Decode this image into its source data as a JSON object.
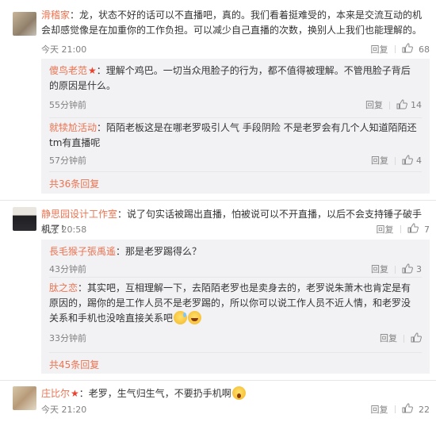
{
  "labels": {
    "reply": "回复"
  },
  "comments": [
    {
      "user": "滑稽家",
      "text": "：龙，状态不好的话可以不直播吧，真的。我们看着挺难受的，本来是交流互动的机会却感觉像是在加重你的工作负担。可以减少自己直播的次数，换别人上我们也能理解的。",
      "time": "今天 21:00",
      "likes": "68",
      "replies": [
        {
          "user": "傻鸟老范",
          "badge": "★",
          "text": "：理解个鸡巴。一切当众甩脸子的行为，都不值得被理解。不管甩脸子背后的原因是什么。",
          "time": "55分钟前",
          "likes": "14"
        },
        {
          "user": "就犊尬活动",
          "badge": "",
          "text": "：陌陌老板这是在哪老罗吸引人气 手段阴险 不是老罗会有几个人知道陌陌还tm有直播呢",
          "time": "57分钟前",
          "likes": "4"
        }
      ],
      "more": "共36条回复"
    },
    {
      "user": "静思园设计工作室",
      "text": "：说了句实话被踢出直播，怕被说可以不开直播，以后不会支持锤子破手机了！",
      "time": "今天 20:58",
      "likes": "7",
      "replies": [
        {
          "user": "長毛猴子張禹遙",
          "badge": "",
          "text": "：那是老罗踢得么？",
          "time": "43分钟前",
          "likes": "3"
        },
        {
          "user": "肽之恋",
          "badge": "",
          "text": "：其实吧，互相理解一下，去陌陌老罗也是卖身去的，老罗说朱萧木也肯定是有原因的，踢你的是工作人员不是老罗踢的，所以你可以说工作人员不近人情，和老罗没关系和手机也没啥直接关系吧",
          "time": "33分钟前",
          "likes": ""
        }
      ],
      "more": "共45条回复"
    },
    {
      "user": "庄比尔",
      "badge": "★",
      "text": "：老罗，生气归生气，不要扔手机啊",
      "time": "今天 21:20",
      "likes": "22"
    }
  ]
}
